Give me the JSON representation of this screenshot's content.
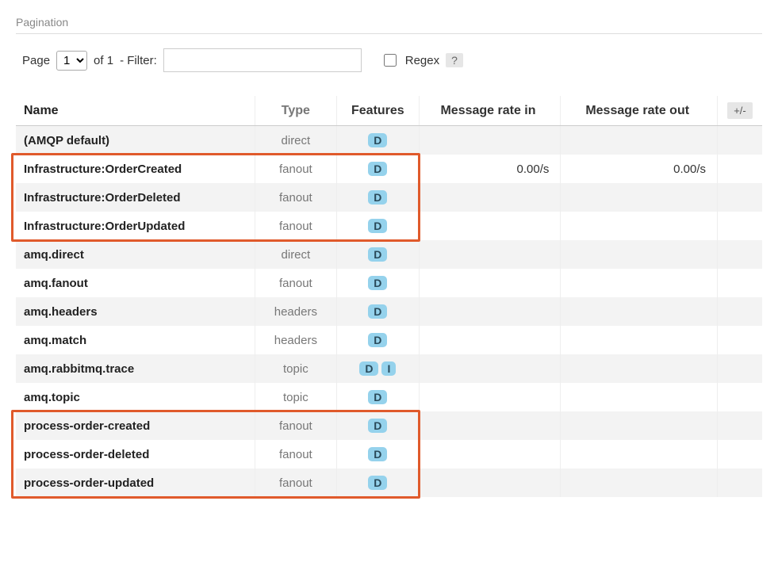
{
  "section": {
    "title": "Pagination"
  },
  "pagination": {
    "page_label": "Page",
    "of_label": "of",
    "total_pages": "1",
    "current_page": "1",
    "filter_label": "- Filter:",
    "filter_value": "",
    "regex_label": "Regex",
    "help_label": "?"
  },
  "table": {
    "headers": {
      "name": "Name",
      "type": "Type",
      "features": "Features",
      "rate_in": "Message rate in",
      "rate_out": "Message rate out",
      "toggle": "+/-"
    },
    "rows": [
      {
        "name": "(AMQP default)",
        "type": "direct",
        "features": [
          "D"
        ],
        "rate_in": "",
        "rate_out": ""
      },
      {
        "name": "Infrastructure:OrderCreated",
        "type": "fanout",
        "features": [
          "D"
        ],
        "rate_in": "0.00/s",
        "rate_out": "0.00/s"
      },
      {
        "name": "Infrastructure:OrderDeleted",
        "type": "fanout",
        "features": [
          "D"
        ],
        "rate_in": "",
        "rate_out": ""
      },
      {
        "name": "Infrastructure:OrderUpdated",
        "type": "fanout",
        "features": [
          "D"
        ],
        "rate_in": "",
        "rate_out": ""
      },
      {
        "name": "amq.direct",
        "type": "direct",
        "features": [
          "D"
        ],
        "rate_in": "",
        "rate_out": ""
      },
      {
        "name": "amq.fanout",
        "type": "fanout",
        "features": [
          "D"
        ],
        "rate_in": "",
        "rate_out": ""
      },
      {
        "name": "amq.headers",
        "type": "headers",
        "features": [
          "D"
        ],
        "rate_in": "",
        "rate_out": ""
      },
      {
        "name": "amq.match",
        "type": "headers",
        "features": [
          "D"
        ],
        "rate_in": "",
        "rate_out": ""
      },
      {
        "name": "amq.rabbitmq.trace",
        "type": "topic",
        "features": [
          "D",
          "I"
        ],
        "rate_in": "",
        "rate_out": ""
      },
      {
        "name": "amq.topic",
        "type": "topic",
        "features": [
          "D"
        ],
        "rate_in": "",
        "rate_out": ""
      },
      {
        "name": "process-order-created",
        "type": "fanout",
        "features": [
          "D"
        ],
        "rate_in": "",
        "rate_out": ""
      },
      {
        "name": "process-order-deleted",
        "type": "fanout",
        "features": [
          "D"
        ],
        "rate_in": "",
        "rate_out": ""
      },
      {
        "name": "process-order-updated",
        "type": "fanout",
        "features": [
          "D"
        ],
        "rate_in": "",
        "rate_out": ""
      }
    ]
  }
}
